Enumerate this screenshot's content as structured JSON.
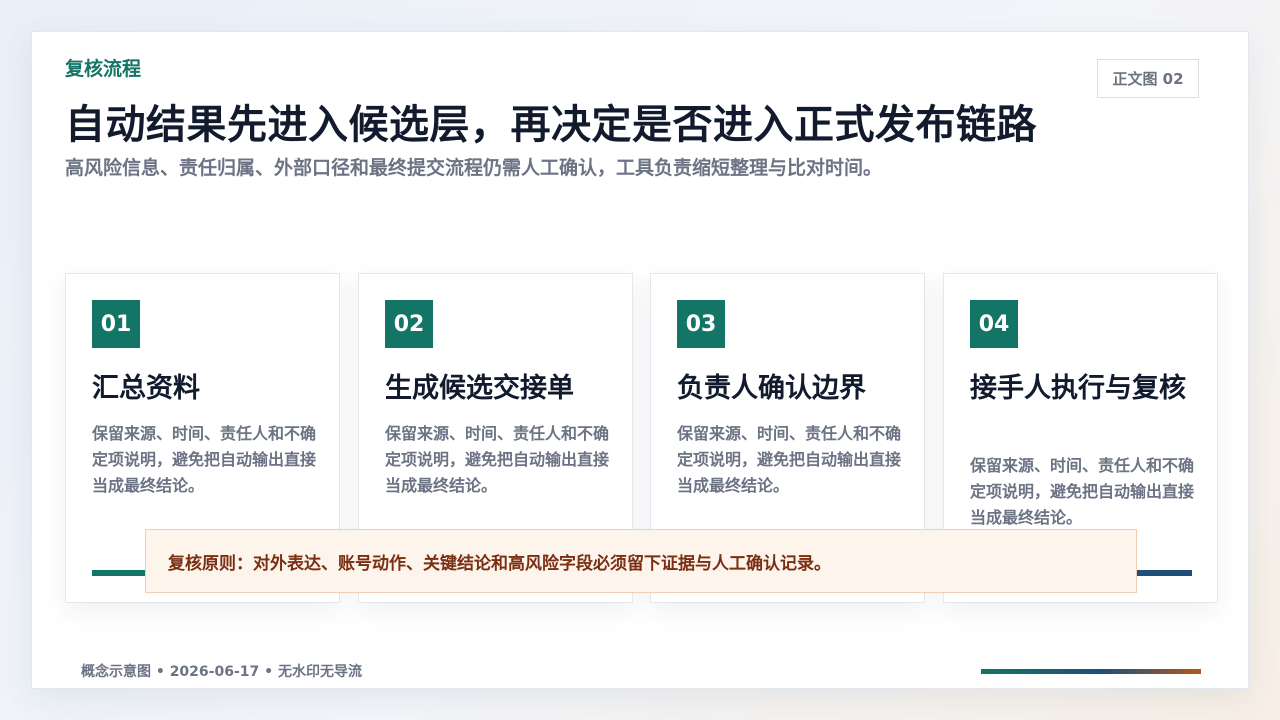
{
  "header": {
    "eyebrow": "复核流程",
    "figure_tag": "正文图 02",
    "title": "自动结果先进入候选层，再决定是否进入正式发布链路",
    "subtitle": "高风险信息、责任归属、外部口径和最终提交流程仍需人工确认，工具负责缩短整理与比对时间。"
  },
  "cards": [
    {
      "number": "01",
      "title": "汇总资料",
      "desc": "保留来源、时间、责任人和不确定项说明，避免把自动输出直接当成最终结论。"
    },
    {
      "number": "02",
      "title": "生成候选交接单",
      "desc": "保留来源、时间、责任人和不确定项说明，避免把自动输出直接当成最终结论。"
    },
    {
      "number": "03",
      "title": "负责人确认边界",
      "desc": "保留来源、时间、责任人和不确定项说明，避免把自动输出直接当成最终结论。"
    },
    {
      "number": "04",
      "title": "接手人执行与复核",
      "desc": "保留来源、时间、责任人和不确定项说明，避免把自动输出直接当成最终结论。"
    }
  ],
  "note": "复核原则：对外表达、账号动作、关键结论和高风险字段必须留下证据与人工确认记录。",
  "footer": "概念示意图 • 2026-06-17 • 无水印无导流",
  "colors": {
    "accent": "#137566",
    "accent_dark": "#1f4e79",
    "warm": "#b05a1a",
    "title": "#121b2e",
    "muted": "#6b7384",
    "note_bg": "#fdf4ec",
    "note_text": "#7a2e12"
  }
}
